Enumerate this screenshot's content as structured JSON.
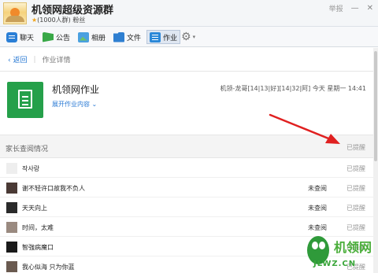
{
  "window": {
    "title": "机领网超级资源群",
    "member_count": "(1000人群)",
    "sub_label": "粉丝",
    "star": "★",
    "help_label": "举报",
    "minimize": "—",
    "close": "✕"
  },
  "toolbar": {
    "items": [
      {
        "label": "聊天",
        "icon": "chat-icon"
      },
      {
        "label": "公告",
        "icon": "notice-flag-icon"
      },
      {
        "label": "相册",
        "icon": "album-icon"
      },
      {
        "label": "文件",
        "icon": "folder-icon"
      },
      {
        "label": "作业",
        "icon": "homework-icon",
        "active": true
      }
    ],
    "settings_icon": "gear-icon"
  },
  "breadcrumb": {
    "back": "返回",
    "current": "作业详情"
  },
  "homework": {
    "title": "机领网作业",
    "expand": "展开作业内容",
    "meta": "机领-龙哥[14|13|好][14|32|阿] 今天 星期一 14:41",
    "icon": "document-icon"
  },
  "parents": {
    "section_title": "家长查阅情况",
    "section_status": "已提醒",
    "rows": [
      {
        "name": "작사랑",
        "state": "",
        "remind": "已提醒",
        "avatar_color": "#e8e8e8"
      },
      {
        "name": "谢不轻许口故我不负人",
        "state": "未查阅",
        "remind": "已提醒",
        "avatar_color": "#4a3a35"
      },
      {
        "name": "天天向上",
        "state": "未查阅",
        "remind": "已提醒",
        "avatar_color": "#2a2a2a"
      },
      {
        "name": "时间，太难",
        "state": "未查阅",
        "remind": "已提醒",
        "avatar_color": "#9a8a80"
      },
      {
        "name": "智強病魔口",
        "state": "未查阅",
        "remind": "已提醒",
        "avatar_color": "#1a1a1a"
      },
      {
        "name": "我心似海 只为你蓝",
        "state": "",
        "remind": "已提醒",
        "avatar_color": "#6a5a50"
      }
    ]
  },
  "watermark": {
    "text": "JLWZ.CN",
    "brand": "机领网"
  },
  "colors": {
    "accent": "#2a7ad4",
    "doc_green": "#25a04a",
    "arrow_red": "#e02020"
  }
}
